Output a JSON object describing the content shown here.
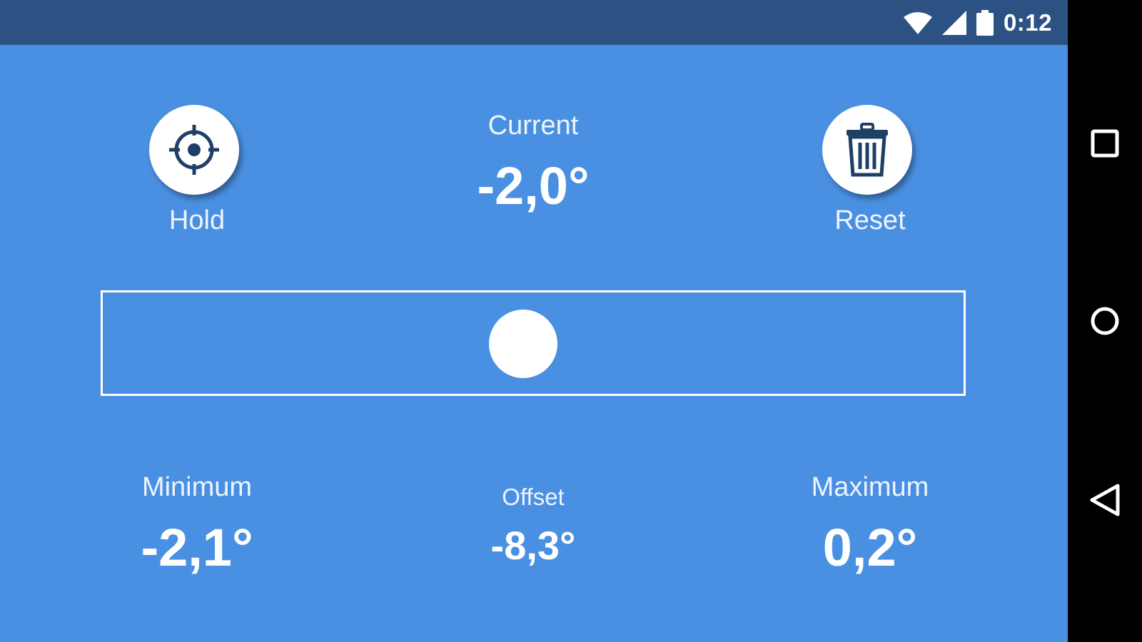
{
  "status_bar": {
    "time": "0:12",
    "icons": [
      "wifi-icon",
      "cell-signal-icon",
      "battery-icon"
    ]
  },
  "hold": {
    "label": "Hold",
    "icon": "crosshair-icon"
  },
  "reset": {
    "label": "Reset",
    "icon": "trash-icon"
  },
  "current": {
    "label": "Current",
    "value": "-2,0°"
  },
  "minimum": {
    "label": "Minimum",
    "value": "-2,1°"
  },
  "offset": {
    "label": "Offset",
    "value": "-8,3°"
  },
  "maximum": {
    "label": "Maximum",
    "value": "0,2°"
  },
  "nav_bar": {
    "icons": [
      "recents-square-icon",
      "home-circle-icon",
      "back-triangle-icon"
    ]
  },
  "colors": {
    "background": "#4a90e2",
    "status_bar": "#2b5283",
    "icon_dark": "#1f3f66",
    "nav_bar": "#000000"
  }
}
